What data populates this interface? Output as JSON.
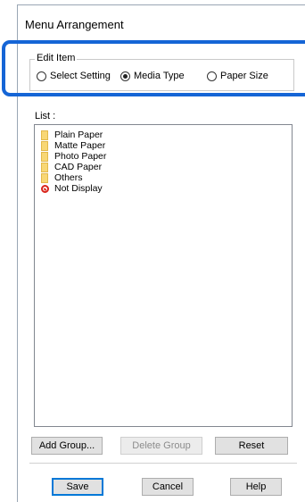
{
  "dialog": {
    "title": "Menu Arrangement"
  },
  "edit_item": {
    "group_label": "Edit Item",
    "options": [
      {
        "label": "Select Setting",
        "checked": false
      },
      {
        "label": "Media Type",
        "checked": true
      },
      {
        "label": "Paper Size",
        "checked": false
      }
    ]
  },
  "list": {
    "label": "List :",
    "items": [
      {
        "label": "Plain Paper",
        "icon": "folder-icon"
      },
      {
        "label": "Matte Paper",
        "icon": "folder-icon"
      },
      {
        "label": "Photo Paper",
        "icon": "folder-icon"
      },
      {
        "label": "CAD Paper",
        "icon": "folder-icon"
      },
      {
        "label": "Others",
        "icon": "folder-icon"
      },
      {
        "label": "Not Display",
        "icon": "not-display-icon"
      }
    ]
  },
  "actions": {
    "add_group": "Add Group...",
    "delete_group": "Delete Group",
    "reset": "Reset"
  },
  "footer": {
    "save": "Save",
    "cancel": "Cancel",
    "help": "Help"
  },
  "colors": {
    "highlight": "#1565d6",
    "folder": "#f8d775",
    "not_display": "#d9241b"
  }
}
